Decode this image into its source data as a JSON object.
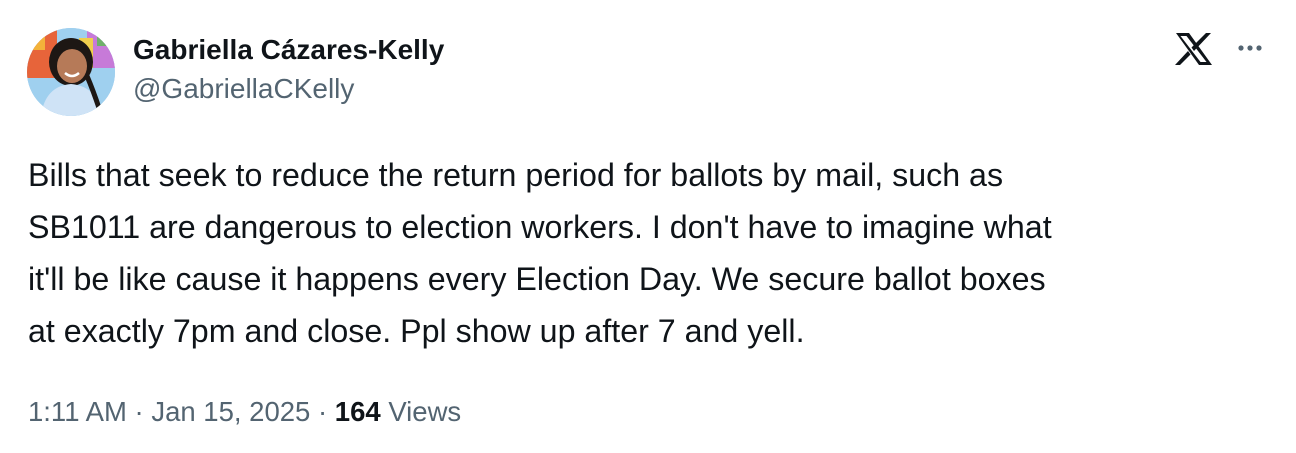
{
  "author": {
    "display_name": "Gabriella Cázares-Kelly",
    "handle": "@GabriellaCKelly"
  },
  "tweet": {
    "text": "Bills that seek to reduce the return period for ballots by mail, such as\nSB1011 are dangerous to election workers. I don't have to imagine what\nit'll be like cause it happens every Election Day. We secure ballot boxes\nat exactly 7pm and close. Ppl show up after 7 and yell."
  },
  "meta": {
    "time": "1:11 AM",
    "separator": " · ",
    "date": "Jan 15, 2025",
    "views_count": "164",
    "views_label": " Views"
  },
  "icons": {
    "brand": "x-logo-icon",
    "more": "more-dots-icon"
  },
  "colors": {
    "text_primary": "#0f1419",
    "text_secondary": "#536471",
    "background": "#ffffff"
  }
}
